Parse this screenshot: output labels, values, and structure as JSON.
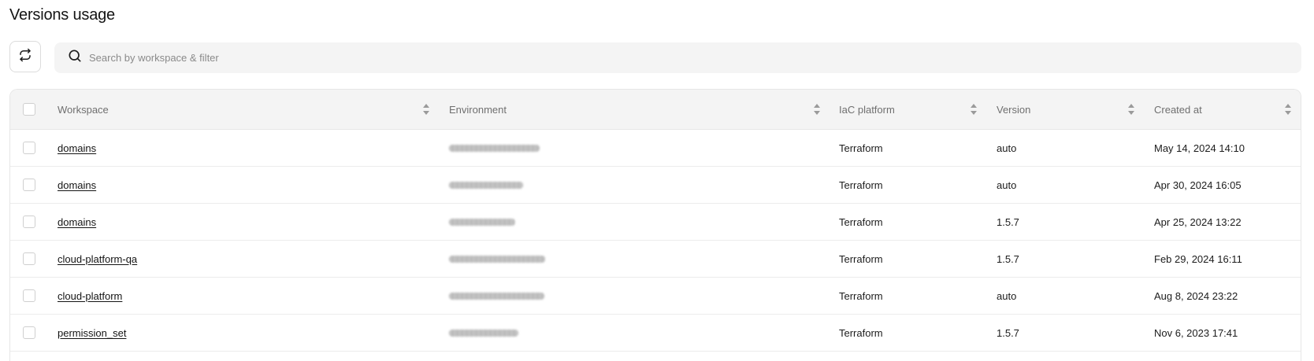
{
  "page": {
    "title": "Versions usage"
  },
  "search": {
    "placeholder": "Search by workspace & filter"
  },
  "table": {
    "columns": [
      {
        "key": "workspace",
        "label": "Workspace"
      },
      {
        "key": "environment",
        "label": "Environment"
      },
      {
        "key": "iac_platform",
        "label": "IaC platform"
      },
      {
        "key": "version",
        "label": "Version"
      },
      {
        "key": "created_at",
        "label": "Created at"
      }
    ],
    "rows": [
      {
        "workspace": "domains",
        "environment": "[redacted]",
        "iac_platform": "Terraform",
        "version": "auto",
        "created_at": "May 14, 2024 14:10"
      },
      {
        "workspace": "domains",
        "environment": "[redacted]",
        "iac_platform": "Terraform",
        "version": "auto",
        "created_at": "Apr 30, 2024 16:05"
      },
      {
        "workspace": "domains",
        "environment": "[redacted]",
        "iac_platform": "Terraform",
        "version": "1.5.7",
        "created_at": "Apr 25, 2024 13:22"
      },
      {
        "workspace": "cloud-platform-qa",
        "environment": "[redacted]",
        "iac_platform": "Terraform",
        "version": "1.5.7",
        "created_at": "Feb 29, 2024 16:11"
      },
      {
        "workspace": "cloud-platform",
        "environment": "[redacted]",
        "iac_platform": "Terraform",
        "version": "auto",
        "created_at": "Aug 8, 2024 23:22"
      },
      {
        "workspace": "permission_set",
        "environment": "[redacted]",
        "iac_platform": "Terraform",
        "version": "1.5.7",
        "created_at": "Nov 6, 2023 17:41"
      }
    ]
  },
  "icons": {
    "refresh": "refresh-icon",
    "search": "search-icon",
    "sort": "sort-icon"
  },
  "colors": {
    "header_bg": "#f4f4f4",
    "border": "#e6e6e6",
    "text": "#141414",
    "muted": "#6f6f6f"
  }
}
